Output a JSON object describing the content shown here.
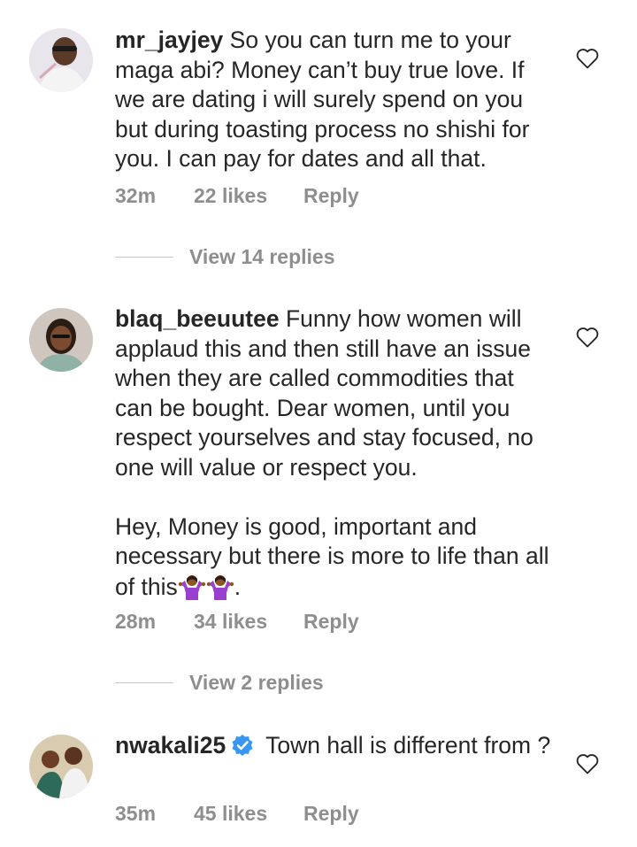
{
  "comments": [
    {
      "username": "mr_jayjey",
      "text": "So you can turn me to your maga abi? Money can’t buy true love. If we are dating i will surely spend on you but during toasting process no shishi for you. I can pay for dates and all that.",
      "time": "32m",
      "likes": "22 likes",
      "reply": "Reply",
      "view_replies": "View 14 replies"
    },
    {
      "username": "blaq_beeuutee",
      "text": "Funny how women will applaud this and then still have an issue when they are called commodities that can be bought. Dear women, until you respect yourselves and stay focused, no one will value or respect you.\n\nHey, Money is good, important and necessary but there is more to life than all of this",
      "text_end": ".",
      "emoji": [
        "person-shrugging-emoji",
        "person-shrugging-emoji"
      ],
      "time": "28m",
      "likes": "34 likes",
      "reply": "Reply",
      "view_replies": "View 2 replies"
    },
    {
      "username": "nwakali25",
      "verified": true,
      "text": "Town hall is different from ?",
      "time": "35m",
      "likes": "45 likes",
      "reply": "Reply"
    }
  ],
  "colors": {
    "text": "#262626",
    "meta": "#8e8e8e",
    "verified": "#3897f0",
    "emoji": "#9b3fd0"
  }
}
